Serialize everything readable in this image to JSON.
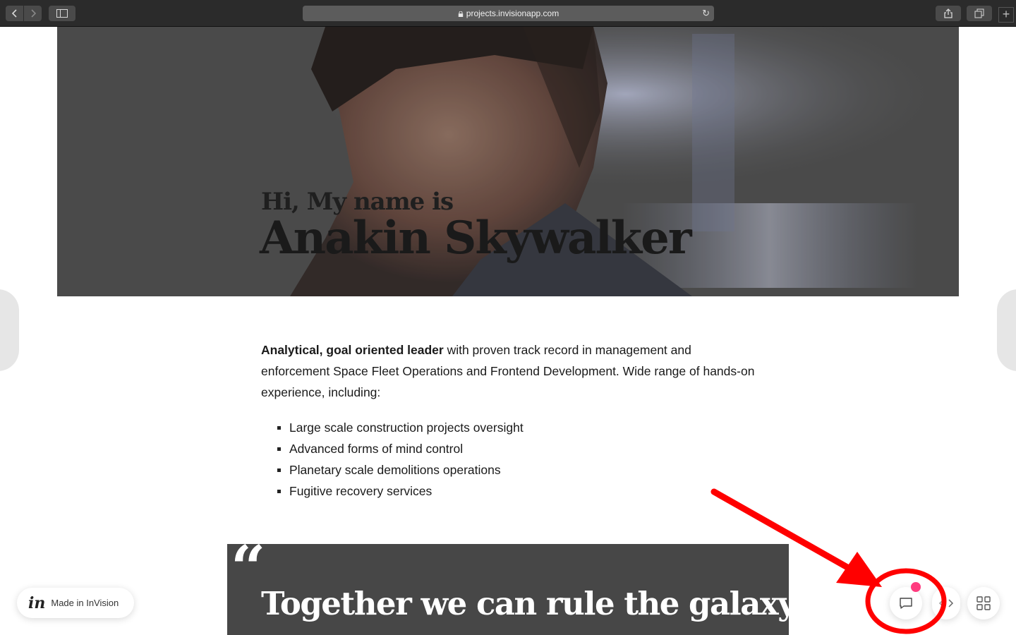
{
  "browser": {
    "url": "projects.invisionapp.com",
    "new_tab": "+"
  },
  "hero": {
    "subtitle": "Hi, My name is",
    "name": "Anakin Skywalker"
  },
  "intro": {
    "bold": "Analytical, goal oriented leader",
    "rest": " with proven track record in management and enforcement Space Fleet Operations and Frontend Development. Wide range of hands-on experience, including:"
  },
  "skills": [
    "Large scale construction projects oversight",
    "Advanced forms of mind control",
    "Planetary scale demolitions operations",
    "Fugitive recovery services"
  ],
  "quote": {
    "mark": "“",
    "text": "Together we can rule the galaxy"
  },
  "invision": {
    "logo": "in",
    "label": "Made in InVision"
  },
  "colors": {
    "annotation": "#ff0000",
    "notification": "#ff3b7f"
  }
}
